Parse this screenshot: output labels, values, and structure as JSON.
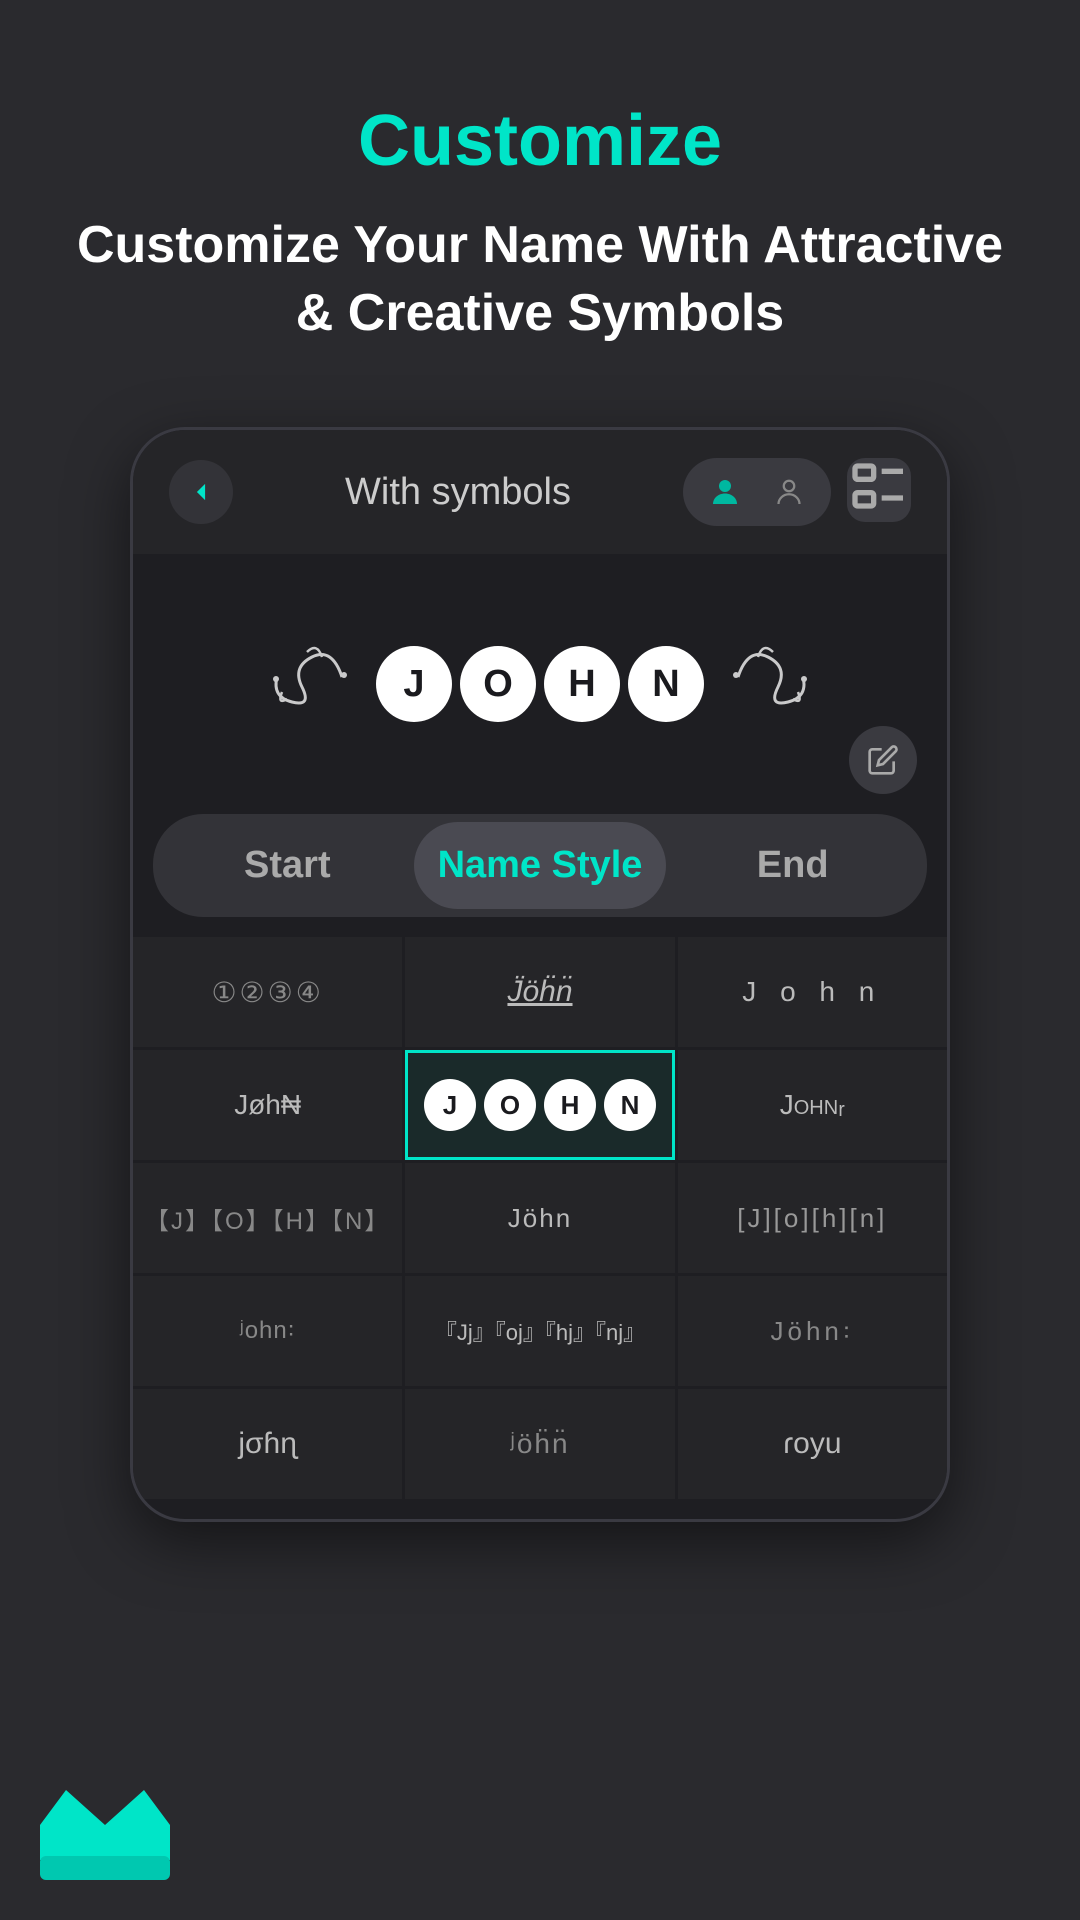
{
  "page": {
    "background_color": "#2a2a2e",
    "title": "Customize",
    "subtitle": "Customize Your Name With Attractive & Creative Symbols"
  },
  "screen": {
    "top_bar": {
      "back_label": "back",
      "screen_title": "With  symbols",
      "icon1": "person-icon",
      "icon2": "person-outline-icon",
      "icon3": "grid-icon"
    },
    "preview": {
      "name": "JOHN",
      "letters": [
        "J",
        "O",
        "H",
        "N"
      ],
      "style": "circle-letters"
    },
    "tabs": [
      {
        "id": "start",
        "label": "Start",
        "active": false
      },
      {
        "id": "name-style",
        "label": "Name Style",
        "active": true
      },
      {
        "id": "end",
        "label": "End",
        "active": false
      }
    ],
    "styles": [
      {
        "id": "style-1",
        "display": "①②③④",
        "selected": false
      },
      {
        "id": "style-2",
        "display": "J̈öḧn̈",
        "selected": false
      },
      {
        "id": "style-3",
        "display": "J o h n",
        "selected": false
      },
      {
        "id": "style-4",
        "display": "Jøh₦",
        "selected": false
      },
      {
        "id": "style-5",
        "display": "●J●O●H●N●",
        "selected": true
      },
      {
        "id": "style-6",
        "display": "Johnᵣ",
        "selected": false
      },
      {
        "id": "style-7",
        "display": "【J】【O】【H】【N】",
        "selected": false
      },
      {
        "id": "style-8",
        "display": "Jöhn",
        "selected": false
      },
      {
        "id": "style-9",
        "display": "[J][o][h][n]",
        "selected": false
      },
      {
        "id": "style-10",
        "display": "ʲoʰnˢ",
        "selected": false
      },
      {
        "id": "style-11",
        "display": "『Jj』『oj』『hj』『nj』",
        "selected": false
      },
      {
        "id": "style-12",
        "display": "Jöhn꞉",
        "selected": false
      },
      {
        "id": "style-13",
        "display": "jσɦɳ",
        "selected": false
      },
      {
        "id": "style-14",
        "display": "ʲöhn",
        "selected": false
      },
      {
        "id": "style-15",
        "display": "ɾoyu",
        "selected": false
      }
    ]
  },
  "crown": {
    "label": "crown-icon"
  }
}
